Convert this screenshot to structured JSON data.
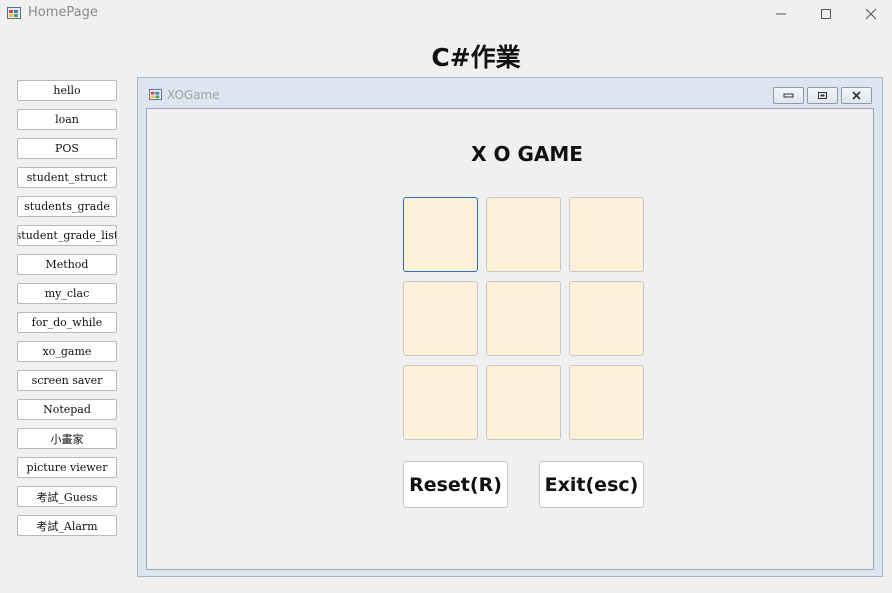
{
  "window": {
    "title": "HomePage"
  },
  "heading": "C#作業",
  "nav": {
    "items": [
      "hello",
      "loan",
      "POS",
      "student_struct",
      "students_grade",
      "student_grade_list",
      "Method",
      "my_clac",
      "for_do_while",
      "xo_game",
      "screen saver",
      "Notepad",
      "小畫家",
      "picture viewer",
      "考試_Guess",
      "考試_Alarm"
    ]
  },
  "child_window": {
    "title": "XOGame",
    "game_title": "X O GAME",
    "cells": [
      "",
      "",
      "",
      "",
      "",
      "",
      "",
      "",
      ""
    ],
    "reset_label": "Reset(R)",
    "exit_label": "Exit(esc)"
  },
  "colors": {
    "cell_bg": "#fff0da",
    "focus_border": "#2d6fb0"
  },
  "icons": [
    "app-icon",
    "minimize-icon",
    "maximize-icon",
    "close-icon",
    "child-minimize-icon",
    "child-restore-icon",
    "child-close-icon"
  ]
}
